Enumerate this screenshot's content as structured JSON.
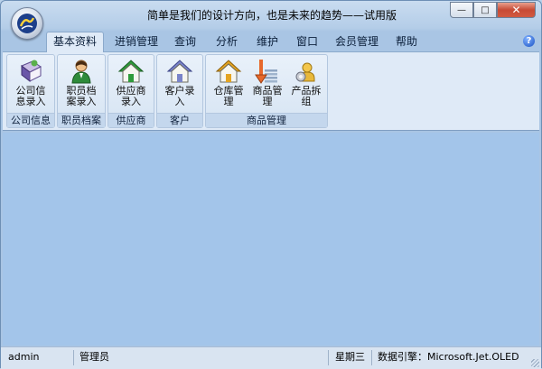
{
  "window": {
    "title": "简单是我们的设计方向，也是未来的趋势——试用版"
  },
  "window_controls": {
    "minimize": "—",
    "maximize": "□",
    "close": "✕"
  },
  "menu": {
    "tabs": [
      {
        "label": "基本资料"
      },
      {
        "label": "进销管理"
      },
      {
        "label": "查询"
      },
      {
        "label": "分析"
      },
      {
        "label": "维护"
      },
      {
        "label": "窗口"
      },
      {
        "label": "会员管理"
      },
      {
        "label": "帮助"
      }
    ],
    "help_glyph": "?"
  },
  "ribbon": {
    "groups": [
      {
        "label": "公司信息",
        "buttons": [
          {
            "label": "公司信\n息录入",
            "icon": "book-icon"
          }
        ]
      },
      {
        "label": "职员档案",
        "buttons": [
          {
            "label": "职员档\n案录入",
            "icon": "person-icon"
          }
        ]
      },
      {
        "label": "供应商",
        "buttons": [
          {
            "label": "供应商\n录入",
            "icon": "house-green-icon"
          }
        ]
      },
      {
        "label": "客户",
        "buttons": [
          {
            "label": "客户录\n入",
            "icon": "house-blue-icon"
          }
        ]
      },
      {
        "label": "商品管理",
        "buttons": [
          {
            "label": "仓库管\n理",
            "icon": "house-yellow-icon"
          },
          {
            "label": "商品管\n理",
            "icon": "stack-arrow-icon"
          },
          {
            "label": "产品拆\n组",
            "icon": "gear-user-icon"
          }
        ]
      }
    ]
  },
  "status": {
    "user": "admin",
    "role": "管理员",
    "weekday": "星期三",
    "engine": "数据引擎：Microsoft.Jet.OLED"
  },
  "colors": {
    "workspace": "#a3c5ea",
    "ribbon": "#dfeaf7",
    "accent": "#1c53c4"
  }
}
